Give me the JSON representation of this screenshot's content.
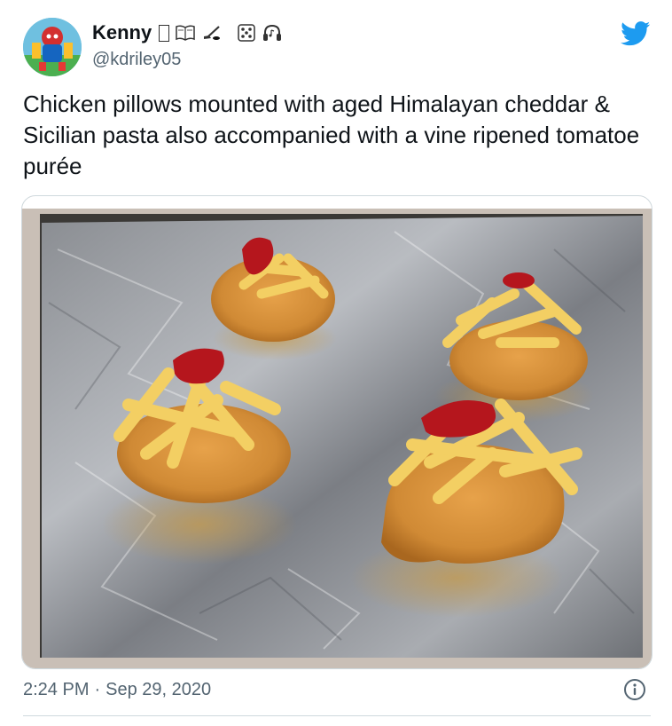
{
  "author": {
    "display_name": "Kenny",
    "handle": "@kdriley05",
    "avatar_icon": "cartoon-character-avatar",
    "name_emoji_icons": [
      "unknown-glyph-box",
      "open-book-icon",
      "hockey-stick-puck-icon",
      "dice-icon",
      "headphones-icon"
    ]
  },
  "tweet": {
    "text": "Chicken pillows mounted with aged Himalayan cheddar & Sicilian  pasta also accompanied with a vine ripened tomatoe purée",
    "media_description_icon": "food-photo",
    "time": "2:24 PM",
    "separator": "·",
    "date": "Sep 29, 2020"
  },
  "icons": {
    "brand": "twitter-bird-icon",
    "info": "info-icon"
  },
  "colors": {
    "twitter_blue": "#1d9bf0",
    "text_primary": "#0f1419",
    "text_secondary": "#536471",
    "border": "#cfd9de"
  }
}
